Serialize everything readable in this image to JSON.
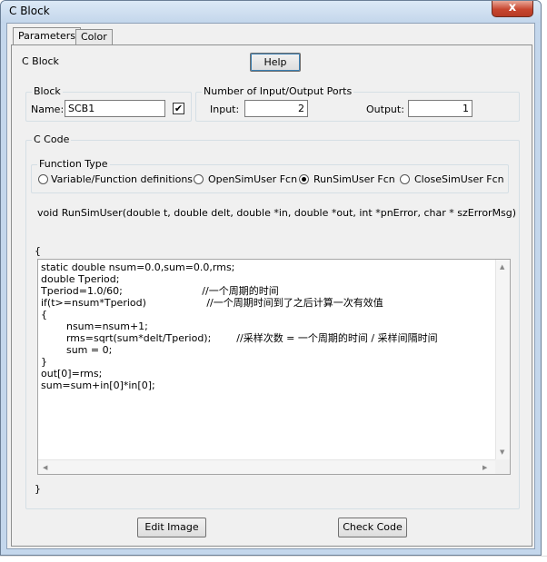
{
  "window": {
    "title": "C Block",
    "close_glyph": "x"
  },
  "tabs": [
    {
      "label": "Parameters",
      "active": true
    },
    {
      "label": "Color",
      "active": false
    }
  ],
  "header": {
    "block_type_label": "C Block",
    "help_label": "Help"
  },
  "block_group": {
    "legend": "Block",
    "name_label": "Name:",
    "name_value": "SCB1",
    "checkbox_checked": true
  },
  "ports_group": {
    "legend": "Number of Input/Output Ports",
    "input_label": "Input:",
    "input_value": "2",
    "output_label": "Output:",
    "output_value": "1"
  },
  "code_group": {
    "legend": "C Code",
    "function_type": {
      "legend": "Function Type",
      "options": [
        {
          "label": "Variable/Function definitions",
          "selected": false
        },
        {
          "label": "OpenSimUser Fcn",
          "selected": false
        },
        {
          "label": "RunSimUser Fcn",
          "selected": true
        },
        {
          "label": "CloseSimUser Fcn",
          "selected": false
        }
      ]
    },
    "signature": "void RunSimUser(double t, double delt, double *in, double *out, int *pnError, char * szErrorMsg)",
    "open_brace": "{",
    "close_brace": "}",
    "code": "static double nsum=0.0,sum=0.0,rms;\ndouble Tperiod;\nTperiod=1.0/60;                         //一个周期的时间\nif(t>=nsum*Tperiod)                   //一个周期时间到了之后计算一次有效值\n{\n        nsum=nsum+1;\n        rms=sqrt(sum*delt/Tperiod);        //采样次数 = 一个周期的时间 / 采样间隔时间\n        sum = 0;\n}\nout[0]=rms;\nsum=sum+in[0]*in[0];"
  },
  "footer": {
    "edit_image_label": "Edit Image",
    "check_code_label": "Check Code"
  },
  "scroll_arrows": {
    "up": "▲",
    "down": "▼",
    "left": "◀",
    "right": "▶"
  }
}
